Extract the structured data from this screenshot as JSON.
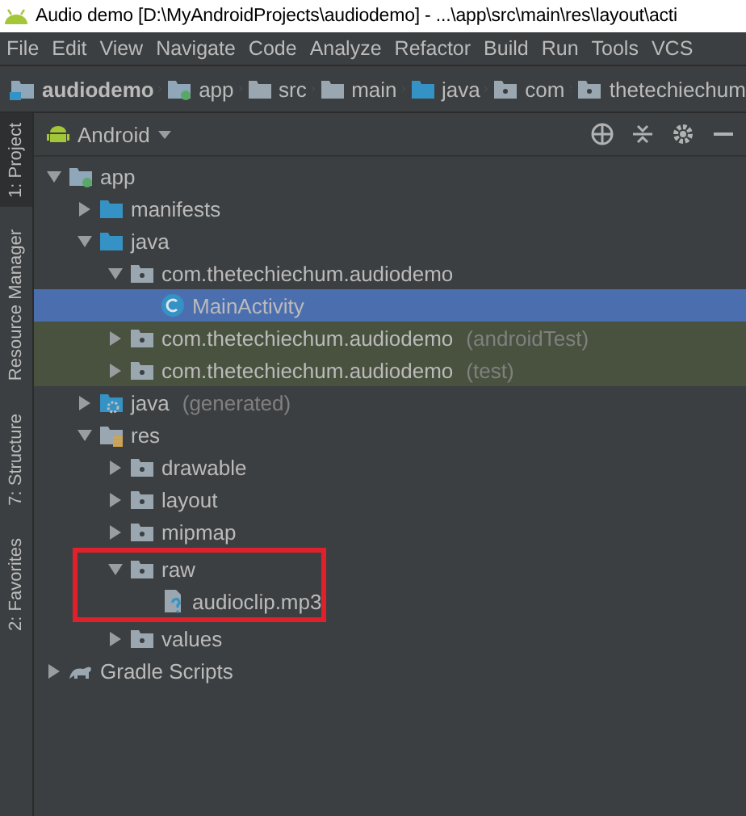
{
  "window": {
    "title": "Audio demo [D:\\MyAndroidProjects\\audiodemo] - ...\\app\\src\\main\\res\\layout\\acti"
  },
  "menu": [
    "File",
    "Edit",
    "View",
    "Navigate",
    "Code",
    "Analyze",
    "Refactor",
    "Build",
    "Run",
    "Tools",
    "VCS"
  ],
  "breadcrumbs": [
    {
      "label": "audiodemo",
      "kind": "project"
    },
    {
      "label": "app",
      "kind": "module"
    },
    {
      "label": "src",
      "kind": "folder"
    },
    {
      "label": "main",
      "kind": "folder"
    },
    {
      "label": "java",
      "kind": "source"
    },
    {
      "label": "com",
      "kind": "package"
    },
    {
      "label": "thetechiechum",
      "kind": "package"
    }
  ],
  "side_tabs": [
    {
      "label": "1: Project",
      "selected": true
    },
    {
      "label": "Resource Manager",
      "selected": false
    },
    {
      "label": "7: Structure",
      "selected": false
    },
    {
      "label": "2: Favorites",
      "selected": false
    }
  ],
  "panel": {
    "view": "Android"
  },
  "tree": [
    {
      "label": "app",
      "kind": "module",
      "expanded": true,
      "children": [
        {
          "label": "manifests",
          "kind": "source",
          "expanded": false
        },
        {
          "label": "java",
          "kind": "source",
          "expanded": true,
          "children": [
            {
              "label": "com.thetechiechum.audiodemo",
              "kind": "package",
              "expanded": true,
              "children": [
                {
                  "label": "MainActivity",
                  "kind": "class",
                  "selected": true
                }
              ]
            },
            {
              "label": "com.thetechiechum.audiodemo",
              "suffix": "(androidTest)",
              "kind": "package",
              "tinted": true,
              "expanded": false
            },
            {
              "label": "com.thetechiechum.audiodemo",
              "suffix": "(test)",
              "kind": "package",
              "tinted": true,
              "expanded": false
            }
          ]
        },
        {
          "label": "java",
          "suffix": "(generated)",
          "kind": "generated",
          "expanded": false
        },
        {
          "label": "res",
          "kind": "resources",
          "expanded": true,
          "children": [
            {
              "label": "drawable",
              "kind": "package",
              "expanded": false
            },
            {
              "label": "layout",
              "kind": "package",
              "expanded": false
            },
            {
              "label": "mipmap",
              "kind": "package",
              "expanded": false
            },
            {
              "label": "raw",
              "kind": "package",
              "expanded": true,
              "highlighted": true,
              "children": [
                {
                  "label": "audioclip.mp3",
                  "kind": "file"
                }
              ]
            },
            {
              "label": "values",
              "kind": "package",
              "expanded": false
            }
          ]
        }
      ]
    },
    {
      "label": "Gradle Scripts",
      "kind": "gradle",
      "expanded": false
    }
  ]
}
